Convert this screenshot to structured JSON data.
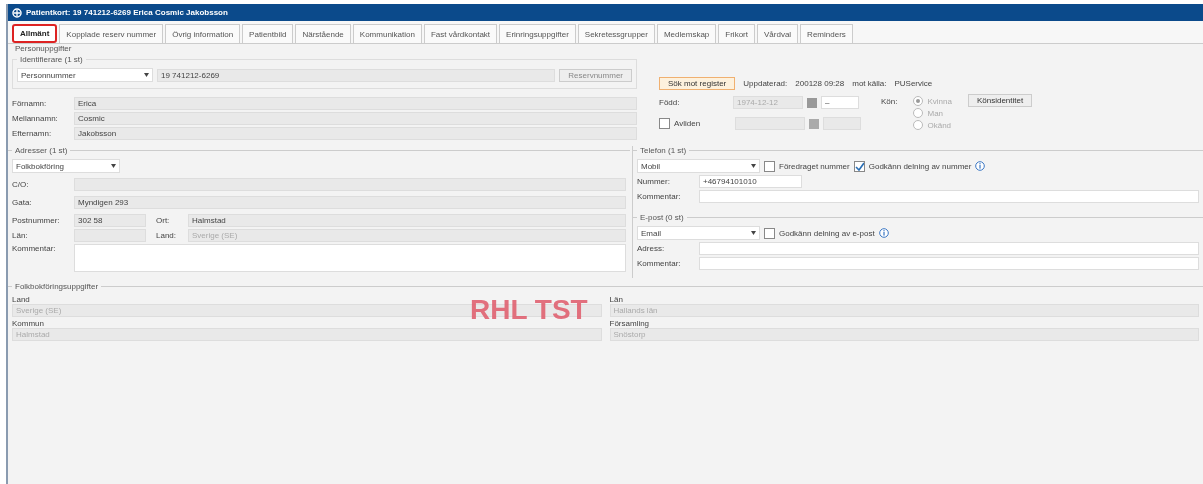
{
  "window": {
    "title": "Patientkort: 19 741212-6269 Erica Cosmic Jakobsson"
  },
  "tabs": [
    {
      "label": "Allmänt",
      "selected": true
    },
    {
      "label": "Kopplade reserv nummer",
      "selected": false
    },
    {
      "label": "Övrig information",
      "selected": false
    },
    {
      "label": "Patientbild",
      "selected": false
    },
    {
      "label": "Närstående",
      "selected": false
    },
    {
      "label": "Kommunikation",
      "selected": false
    },
    {
      "label": "Fast vårdkontakt",
      "selected": false
    },
    {
      "label": "Erinringsuppgifter",
      "selected": false
    },
    {
      "label": "Sekretessgrupper",
      "selected": false
    },
    {
      "label": "Medlemskap",
      "selected": false
    },
    {
      "label": "Frikort",
      "selected": false
    },
    {
      "label": "Vårdval",
      "selected": false
    },
    {
      "label": "Reminders",
      "selected": false
    }
  ],
  "personal": {
    "title": "Personuppgifter",
    "identifiers": {
      "title": "Identifierare (1 st)",
      "type": "Personnummer",
      "value": "19 741212-6269",
      "button": {
        "label": "Reservnummer",
        "disabled": true
      }
    },
    "names": [
      {
        "label": "Förnamn:",
        "value": "Erica"
      },
      {
        "label": "Mellannamn:",
        "value": "Cosmic"
      },
      {
        "label": "Efternamn:",
        "value": "Jakobsson"
      }
    ],
    "register_button": "Sök mot register",
    "updated_label": "Uppdaterad:",
    "updated_value": "200128 09:28",
    "source_label": "mot källa:",
    "source_value": "PUService",
    "born": {
      "label": "Född:",
      "date": "1974-12-12",
      "time": "–"
    },
    "deceased": {
      "label": "Avliden",
      "checked": false
    },
    "gender": {
      "label": "Kön:",
      "options": [
        {
          "label": "Kvinna",
          "selected": true
        },
        {
          "label": "Man",
          "selected": false
        },
        {
          "label": "Okänd",
          "selected": false
        }
      ],
      "button": "Könsidentitet"
    }
  },
  "addresses": {
    "title": "Adresser (1 st)",
    "type": "Folkbokföring",
    "rows": [
      {
        "label": "C/O:",
        "value": ""
      },
      {
        "label": "Gata:",
        "value": "Myndigen 293"
      }
    ],
    "postal_label": "Postnummer:",
    "postal": "302 58",
    "city_label": "Ort:",
    "city": "Halmstad",
    "county_label": "Län:",
    "country_label": "Land:",
    "country": "Sverige (SE)",
    "comment_label": "Kommentar:"
  },
  "phone": {
    "title": "Telefon (1 st)",
    "type": "Mobil",
    "options": [
      {
        "label": "Föredraget nummer",
        "checked": false
      },
      {
        "label": "Godkänn delning av nummer",
        "checked": true
      }
    ],
    "number_label": "Nummer:",
    "number": "+46794101010",
    "comment_label": "Kommentar:"
  },
  "email": {
    "title": "E-post (0 st)",
    "type": "Email",
    "options": [
      {
        "label": "Godkänn delning av e-post",
        "checked": false
      }
    ],
    "address_label": "Adress:",
    "comment_label": "Kommentar:"
  },
  "registry": {
    "title": "Folkbokföringsuppgifter",
    "fields": [
      {
        "label": "Land",
        "value": "Sverige (SE)"
      },
      {
        "label": "Län",
        "value": "Hallands län"
      },
      {
        "label": "Kommun",
        "value": "Halmstad"
      },
      {
        "label": "Församling",
        "value": "Snöstorp"
      }
    ]
  },
  "environment": "RHL TST"
}
